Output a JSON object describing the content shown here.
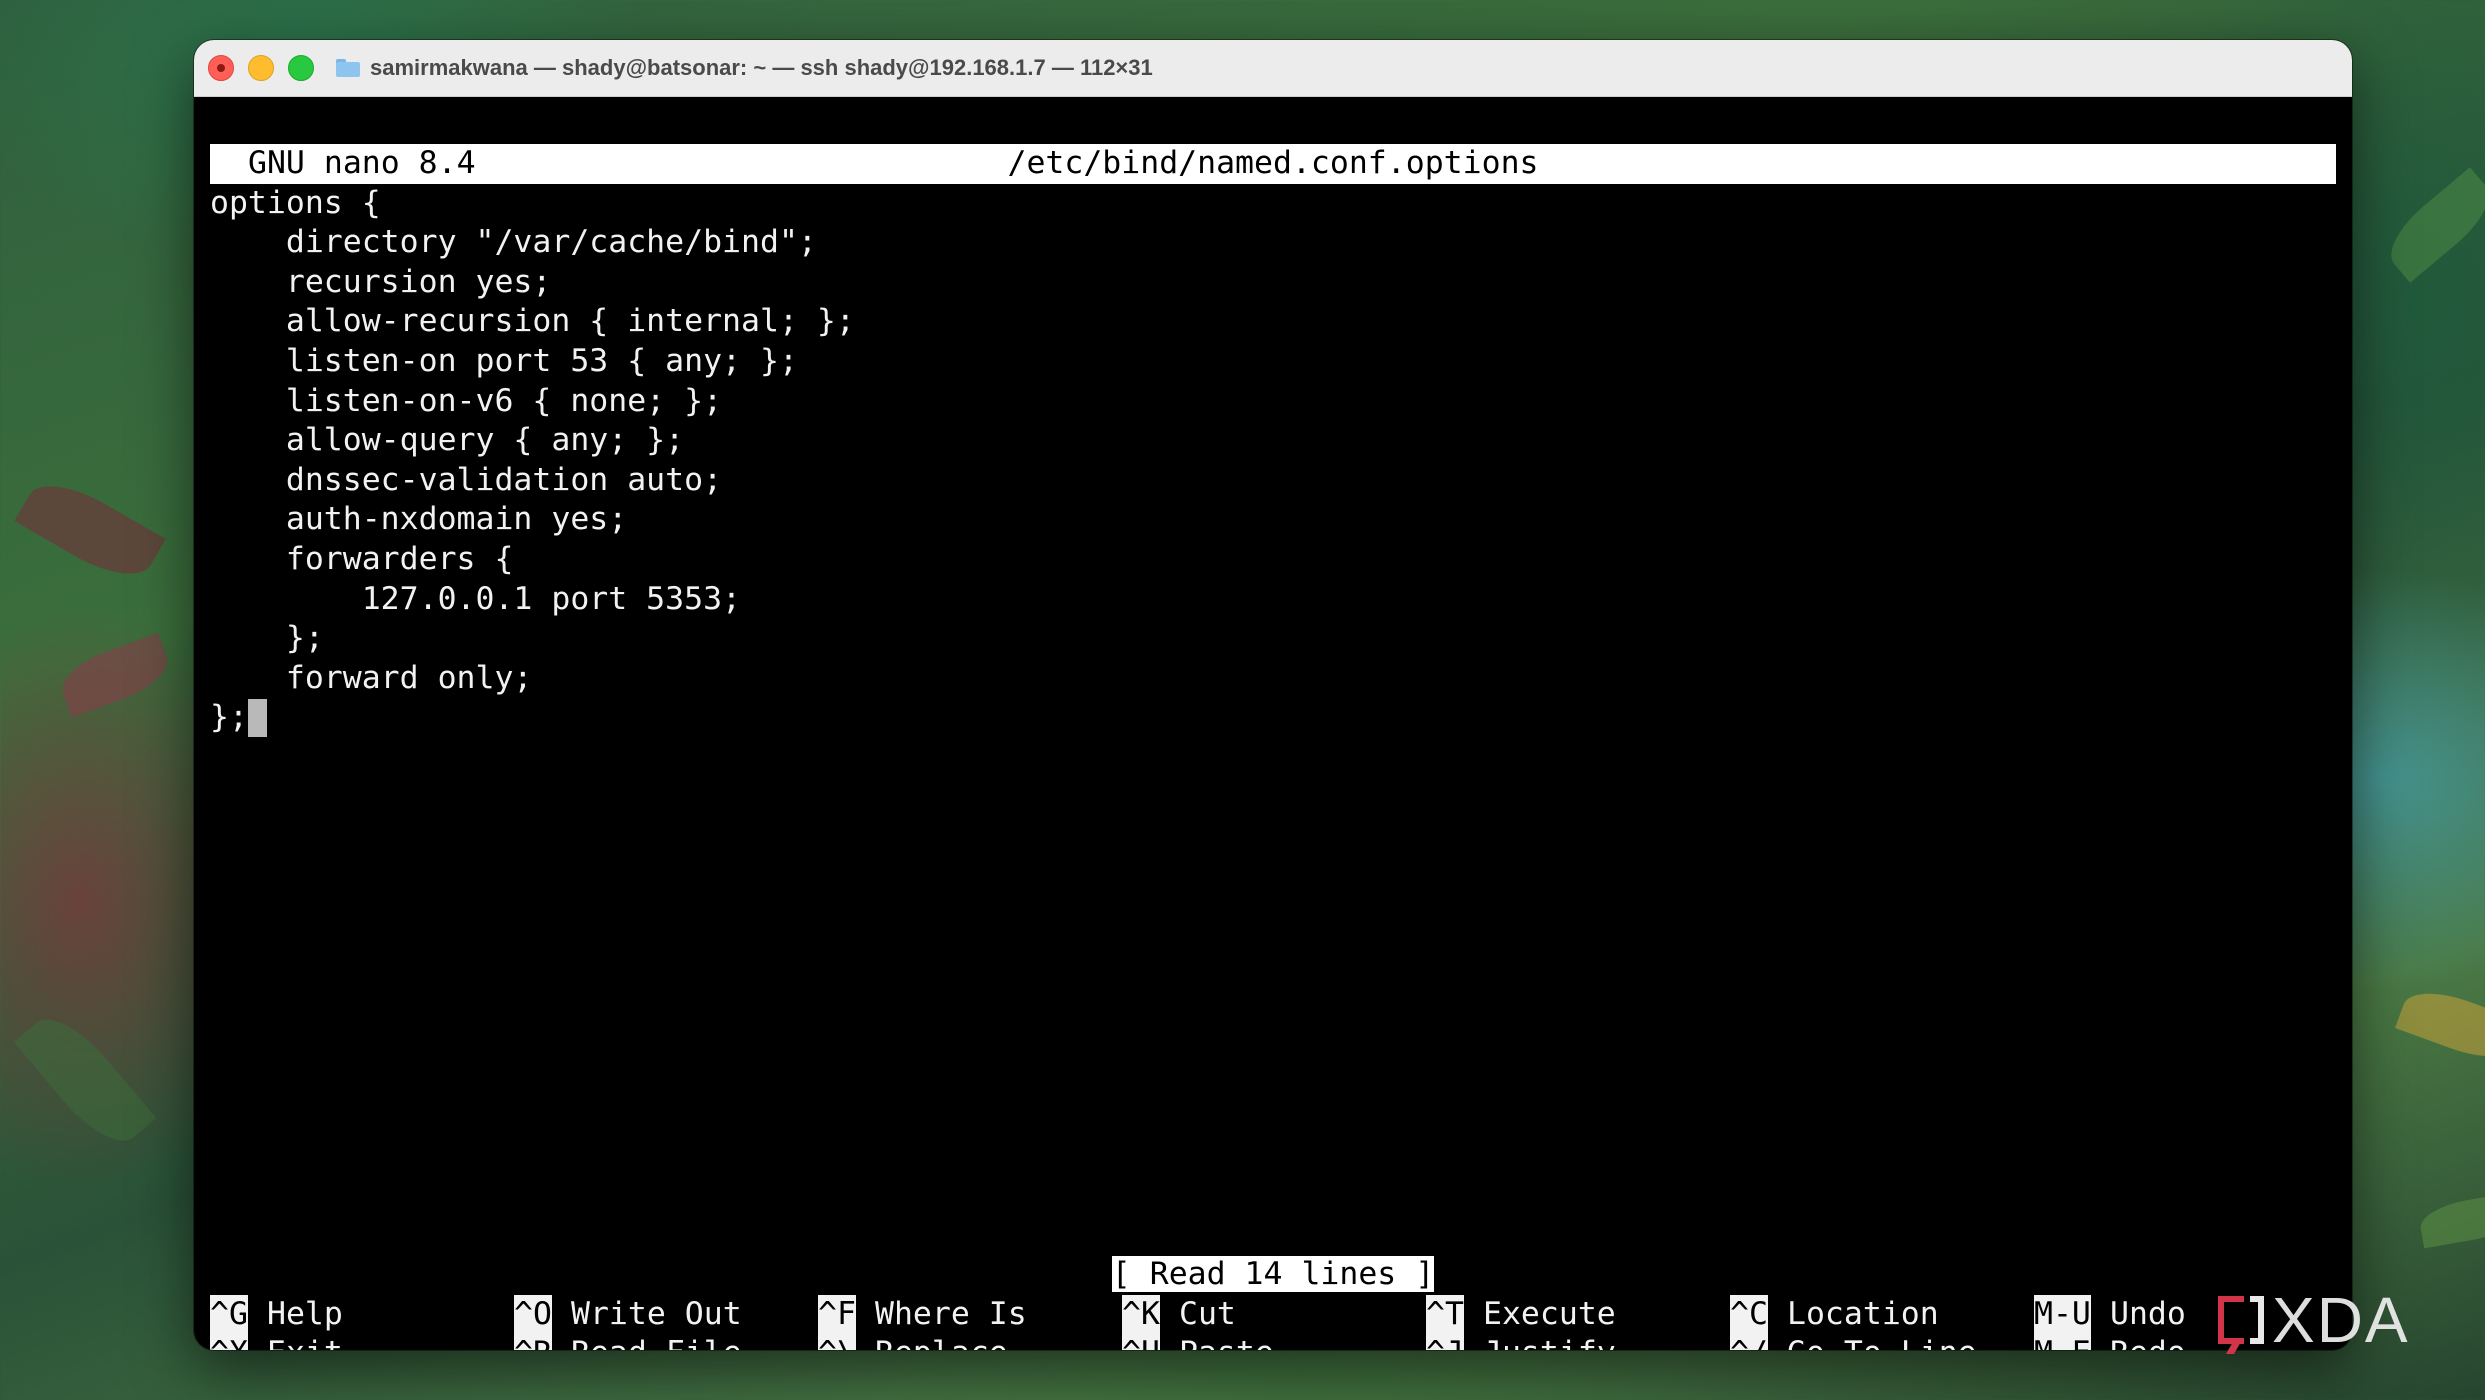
{
  "window": {
    "title": "samirmakwana — shady@batsonar: ~ — ssh shady@192.168.1.7 — 112×31",
    "icons": [
      "close-icon",
      "minimize-icon",
      "zoom-icon",
      "folder-icon"
    ]
  },
  "nano": {
    "version": "GNU nano 8.4",
    "filename": "/etc/bind/named.conf.options",
    "lines": [
      "options {",
      "    directory \"/var/cache/bind\";",
      "    recursion yes;",
      "    allow-recursion { internal; };",
      "    listen-on port 53 { any; };",
      "    listen-on-v6 { none; };",
      "    allow-query { any; };",
      "    dnssec-validation auto;",
      "    auth-nxdomain yes;",
      "    forwarders {",
      "        127.0.0.1 port 5353;",
      "    };",
      "    forward only;",
      "};"
    ],
    "status": "[ Read 14 lines ]",
    "shortcuts": [
      {
        "key": "^G",
        "label": "Help"
      },
      {
        "key": "^O",
        "label": "Write Out"
      },
      {
        "key": "^F",
        "label": "Where Is"
      },
      {
        "key": "^K",
        "label": "Cut"
      },
      {
        "key": "^T",
        "label": "Execute"
      },
      {
        "key": "^C",
        "label": "Location"
      },
      {
        "key": "M-U",
        "label": "Undo"
      },
      {
        "key": "^X",
        "label": "Exit"
      },
      {
        "key": "^R",
        "label": "Read File"
      },
      {
        "key": "^\\",
        "label": "Replace"
      },
      {
        "key": "^U",
        "label": "Paste"
      },
      {
        "key": "^J",
        "label": "Justify"
      },
      {
        "key": "^/",
        "label": "Go To Line"
      },
      {
        "key": "M-E",
        "label": "Redo"
      }
    ]
  },
  "watermark": {
    "text": "XDA"
  }
}
